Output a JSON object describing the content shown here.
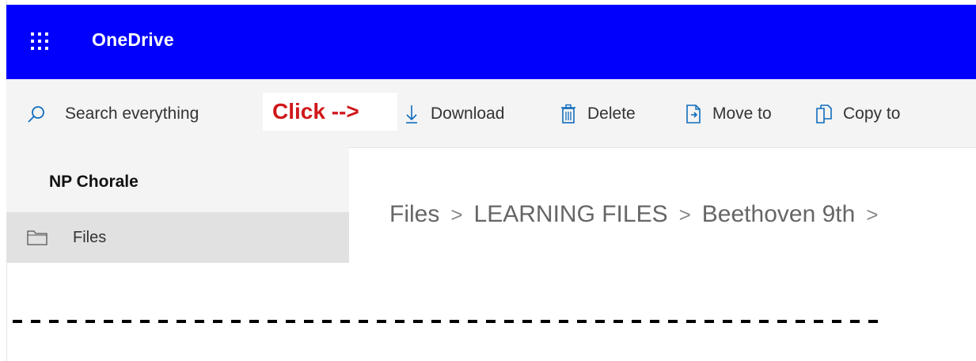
{
  "app": {
    "title": "OneDrive"
  },
  "colors": {
    "header_bg": "#0000fc",
    "callout_text": "#d0171b",
    "nav_bg": "#f4f4f4",
    "nav_selected": "#e1e1e1"
  },
  "toolbar": {
    "search_placeholder": "Search everything",
    "callout": "Click -->",
    "download_label": "Download",
    "delete_label": "Delete",
    "move_label": "Move to",
    "copy_label": "Copy to"
  },
  "sidebar": {
    "site_name": "NP Chorale",
    "items": [
      {
        "label": "Files",
        "icon": "folder-icon"
      }
    ]
  },
  "breadcrumb": {
    "items": [
      "Files",
      "LEARNING FILES",
      "Beethoven 9th"
    ],
    "separator": ">"
  }
}
